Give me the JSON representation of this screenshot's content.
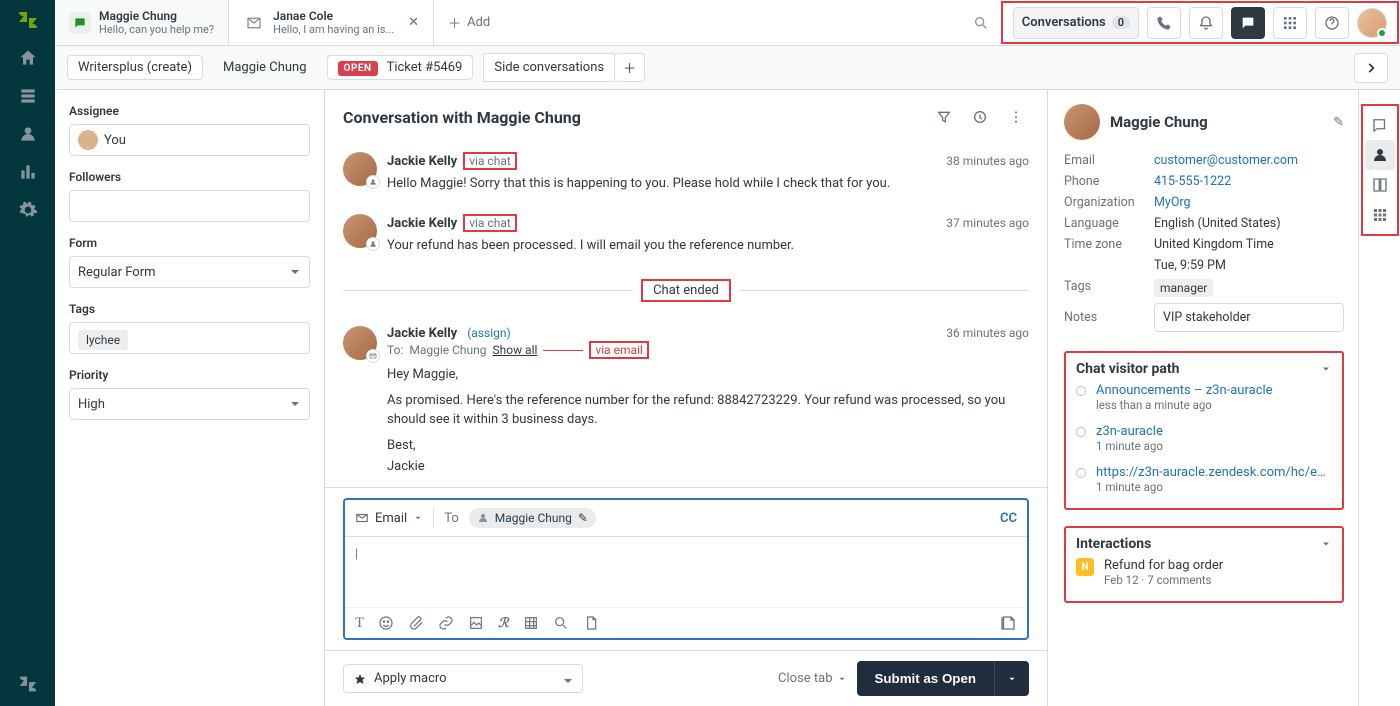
{
  "tabs": [
    {
      "title": "Maggie Chung",
      "subtitle": "Hello, can you help me?",
      "type": "chat",
      "active": true
    },
    {
      "title": "Janae Cole",
      "subtitle": "Hello, I am having an is...",
      "type": "email",
      "active": false
    }
  ],
  "add_tab_label": "Add",
  "top_tools": {
    "conversations_label": "Conversations",
    "conversations_count": "0"
  },
  "breadcrumb": {
    "org": "Writersplus (create)",
    "requester": "Maggie Chung",
    "open_label": "OPEN",
    "ticket_label": "Ticket #5469",
    "side_conv": "Side conversations"
  },
  "fields": {
    "assignee_label": "Assignee",
    "assignee_value": "You",
    "followers_label": "Followers",
    "form_label": "Form",
    "form_value": "Regular Form",
    "tags_label": "Tags",
    "tags_value": "lychee",
    "priority_label": "Priority",
    "priority_value": "High"
  },
  "conversation": {
    "title": "Conversation with Maggie Chung",
    "messages": [
      {
        "author": "Jackie Kelly",
        "via": "via chat",
        "time": "38 minutes ago",
        "body": "Hello Maggie! Sorry that this is happening to you. Please hold while I check that for you."
      },
      {
        "author": "Jackie Kelly",
        "via": "via chat",
        "time": "37 minutes ago",
        "body": "Your refund has been processed. I will email you the reference number."
      }
    ],
    "chat_ended": "Chat ended",
    "email_msg": {
      "author": "Jackie Kelly",
      "assign": "(assign)",
      "time": "36 minutes ago",
      "to_prefix": "To:",
      "to_name": "Maggie Chung",
      "show_all": "Show all",
      "via_email": "via email",
      "greeting": "Hey Maggie,",
      "body": "As promised. Here's the reference number for the refund: 88842723229. Your refund was processed, so you should see it within 3 business days.",
      "closing1": "Best,",
      "closing2": "Jackie"
    }
  },
  "composer": {
    "channel": "Email",
    "to_label": "To",
    "to_chip": "Maggie Chung",
    "cc": "CC",
    "cursor": "|"
  },
  "macro": {
    "label": "Apply macro"
  },
  "footer": {
    "close_tab": "Close tab",
    "submit_prefix": "Submit as ",
    "submit_status": "Open"
  },
  "profile": {
    "name": "Maggie Chung",
    "email_label": "Email",
    "email": "customer@customer.com",
    "phone_label": "Phone",
    "phone": "415-555-1222",
    "org_label": "Organization",
    "org": "MyOrg",
    "lang_label": "Language",
    "lang": "English (United States)",
    "tz_label": "Time zone",
    "tz": "United Kingdom Time",
    "local_time": "Tue, 9:59 PM",
    "tags_label": "Tags",
    "tags": "manager",
    "notes_label": "Notes",
    "notes": "VIP stakeholder"
  },
  "visitor_path": {
    "title": "Chat visitor path",
    "items": [
      {
        "title": "Announcements – z3n-auracle",
        "meta": "less than a minute ago"
      },
      {
        "title": "z3n-auracle",
        "meta": "1 minute ago"
      },
      {
        "title": "https://z3n-auracle.zendesk.com/hc/en...",
        "meta": "1 minute ago"
      }
    ]
  },
  "interactions": {
    "title": "Interactions",
    "items": [
      {
        "title": "Refund for bag order",
        "meta": "Feb 12 · 7 comments"
      }
    ]
  }
}
